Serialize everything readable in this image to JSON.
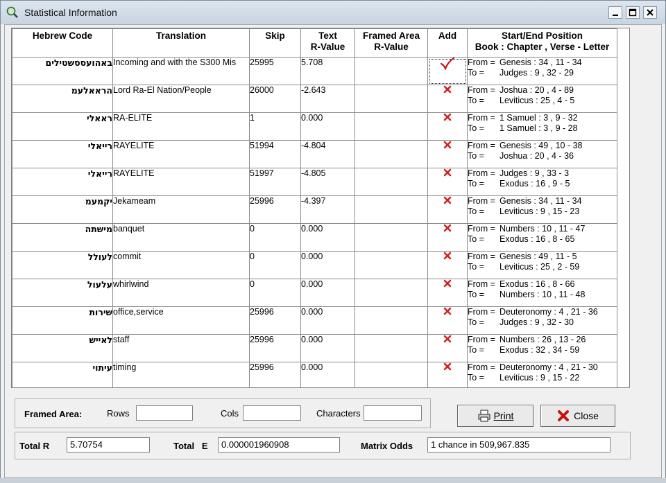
{
  "window": {
    "title": "Statistical Information"
  },
  "grid": {
    "headers": {
      "hebrew_code": "Hebrew Code",
      "translation": "Translation",
      "skip": "Skip",
      "text_r_1": "Text",
      "text_r_2": "R-Value",
      "framed_r_1": "Framed Area",
      "framed_r_2": "R-Value",
      "add": "Add",
      "pos_1": "Start/End Position",
      "pos_2": "Book : Chapter , Verse - Letter"
    },
    "from_label": "From =",
    "to_label": "To =",
    "rows": [
      {
        "hebrew": "באהועססשטילים",
        "translation": "Incoming and with the S300 Mis",
        "skip": "25995",
        "text_r": "5.708",
        "framed_r": "",
        "add": "check",
        "from": "Genesis : 34 , 11 - 34",
        "to": "Judges : 9 , 32 - 29"
      },
      {
        "hebrew": "הראאלעמ",
        "translation": "Lord Ra-El Nation/People",
        "skip": "26000",
        "text_r": "-2.643",
        "framed_r": "",
        "add": "x",
        "from": "Joshua : 20 , 4 - 89",
        "to": "Leviticus : 25 , 4 - 5"
      },
      {
        "hebrew": "ראאלי",
        "translation": "RA-ELITE",
        "skip": "1",
        "text_r": "0.000",
        "framed_r": "",
        "add": "x",
        "from": "1 Samuel : 3 , 9 - 32",
        "to": "1 Samuel : 3 , 9 - 28"
      },
      {
        "hebrew": "רייאלי",
        "translation": "RAYELITE",
        "skip": "51994",
        "text_r": "-4.804",
        "framed_r": "",
        "add": "x",
        "from": "Genesis : 49 , 10 - 38",
        "to": "Joshua : 20 , 4 - 36"
      },
      {
        "hebrew": "רייאלי",
        "translation": "RAYELITE",
        "skip": "51997",
        "text_r": "-4.805",
        "framed_r": "",
        "add": "x",
        "from": "Judges : 9 , 33 - 3",
        "to": "Exodus : 16 , 9 - 5"
      },
      {
        "hebrew": "יקמעמ",
        "translation": "Jekameam",
        "skip": "25996",
        "text_r": "-4.397",
        "framed_r": "",
        "add": "x",
        "from": "Genesis : 34 , 11 - 34",
        "to": "Leviticus : 9 , 15 - 23"
      },
      {
        "hebrew": "מישתה",
        "translation": "banquet",
        "skip": "0",
        "text_r": "0.000",
        "framed_r": "",
        "add": "x",
        "from": "Numbers : 10 , 11 - 47",
        "to": "Exodus : 16 , 8 - 65"
      },
      {
        "hebrew": "לעולל",
        "translation": "commit",
        "skip": "0",
        "text_r": "0.000",
        "framed_r": "",
        "add": "x",
        "from": "Genesis : 49 , 11 - 5",
        "to": "Leviticus : 25 , 2 - 59"
      },
      {
        "hebrew": "עלעול",
        "translation": "whirlwind",
        "skip": "0",
        "text_r": "0.000",
        "framed_r": "",
        "add": "x",
        "from": "Exodus : 16 , 8 - 66",
        "to": "Numbers : 10 , 11 - 48"
      },
      {
        "hebrew": "שירות",
        "translation": "office,service",
        "skip": "25996",
        "text_r": "0.000",
        "framed_r": "",
        "add": "x",
        "from": "Deuteronomy : 4 , 21 - 36",
        "to": "Judges : 9 , 32 - 30"
      },
      {
        "hebrew": "לאייש",
        "translation": "staff",
        "skip": "25996",
        "text_r": "0.000",
        "framed_r": "",
        "add": "x",
        "from": "Numbers : 26 , 13 - 26",
        "to": "Exodus : 32 , 34 - 59"
      },
      {
        "hebrew": "עיתוי",
        "translation": "timing",
        "skip": "25996",
        "text_r": "0.000",
        "framed_r": "",
        "add": "x",
        "from": "Deuteronomy : 4 , 21 - 30",
        "to": "Leviticus : 9 , 15 - 22"
      }
    ]
  },
  "framed_area": {
    "label": "Framed Area:",
    "rows_label": "Rows",
    "rows_value": "",
    "cols_label": "Cols",
    "cols_value": "",
    "chars_label": "Characters",
    "chars_value": ""
  },
  "buttons": {
    "print": "Print",
    "close": "Close"
  },
  "totals": {
    "total_r_label": "Total R",
    "total_r_value": "5.70754",
    "total_e_label": "Total   E",
    "total_e_value": "0.000001960908",
    "matrix_odds_label": "Matrix Odds",
    "matrix_odds_value": "1 chance in 509,967.835"
  },
  "colors": {
    "check": "#c81010",
    "x_mark": "#d42020",
    "titlebar": "#d0dae4"
  }
}
